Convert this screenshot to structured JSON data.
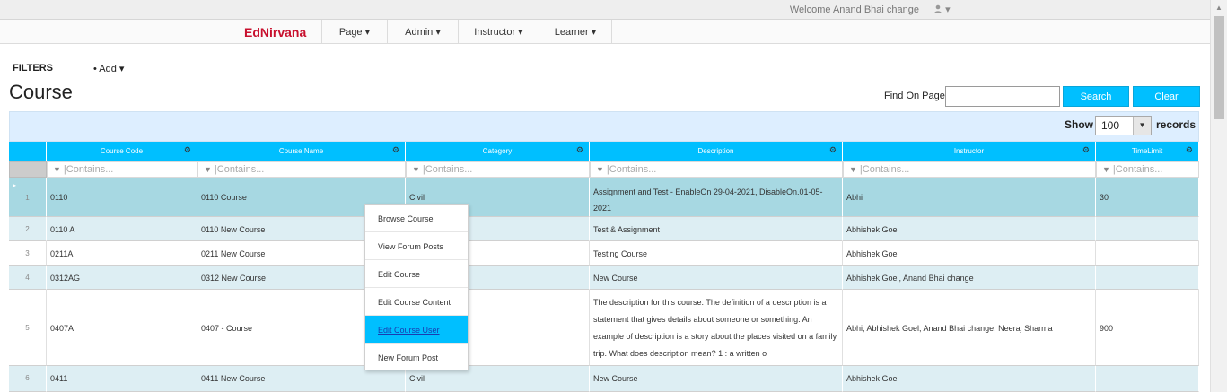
{
  "topbar": {
    "welcome": "Welcome Anand Bhai change",
    "user_menu_caret": "▾"
  },
  "brand": "EdNirvana",
  "nav": [
    {
      "label": "Page ▾"
    },
    {
      "label": "Admin ▾"
    },
    {
      "label": "Instructor ▾"
    },
    {
      "label": "Learner ▾"
    }
  ],
  "filters": {
    "label": "FILTERS",
    "add": "• Add ▾"
  },
  "page_title": "Course",
  "find": {
    "label": "Find On Page",
    "value": "",
    "search_label": "Search",
    "clear_label": "Clear"
  },
  "paging": {
    "show_label": "Show",
    "show_value": "100",
    "records_label": "records"
  },
  "grid": {
    "columns": [
      "Course Code",
      "Course Name",
      "Category",
      "Description",
      "Instructor",
      "TimeLimit"
    ],
    "filter_placeholder": "Contains...",
    "rows": [
      {
        "num": "1",
        "code": "0110",
        "name": "0110 Course",
        "category": "Civil",
        "description": "Assignment and Test - EnableOn 29-04-2021, DisableOn.01-05-2021",
        "instructor": "Abhi",
        "timelimit": "30"
      },
      {
        "num": "2",
        "code": "0110 A",
        "name": "0110 New Course",
        "category": "",
        "description": "Test & Assignment",
        "instructor": "Abhishek Goel",
        "timelimit": ""
      },
      {
        "num": "3",
        "code": "0211A",
        "name": "0211 New Course",
        "category": "",
        "description": "Testing Course",
        "instructor": "Abhishek Goel",
        "timelimit": ""
      },
      {
        "num": "4",
        "code": "0312AG",
        "name": "0312 New Course",
        "category": "",
        "description": "New Course",
        "instructor": "Abhishek Goel, Anand Bhai change",
        "timelimit": ""
      },
      {
        "num": "5",
        "code": "0407A",
        "name": "0407 - Course",
        "category": "",
        "description": "The description for this course. The definition of a description is a statement that gives details about someone or something. An example of description is a story about the places visited on a family trip. What does description mean? 1 : a written o",
        "instructor": "Abhi, Abhishek Goel, Anand Bhai change, Neeraj Sharma",
        "timelimit": "900"
      },
      {
        "num": "6",
        "code": "0411",
        "name": "0411 New Course",
        "category": "Civil",
        "description": "New Course",
        "instructor": "Abhishek Goel",
        "timelimit": ""
      }
    ]
  },
  "context_menu": [
    {
      "label": "Browse Course"
    },
    {
      "label": "View Forum Posts"
    },
    {
      "label": "Edit Course"
    },
    {
      "label": "Edit Course Content"
    },
    {
      "label": "Edit Course User"
    },
    {
      "label": "New Forum Post"
    }
  ],
  "colors": {
    "accent": "#00bfff",
    "brand": "#c8102e",
    "row_selected": "#a7d8e2",
    "row_alt": "#ddeef3"
  }
}
